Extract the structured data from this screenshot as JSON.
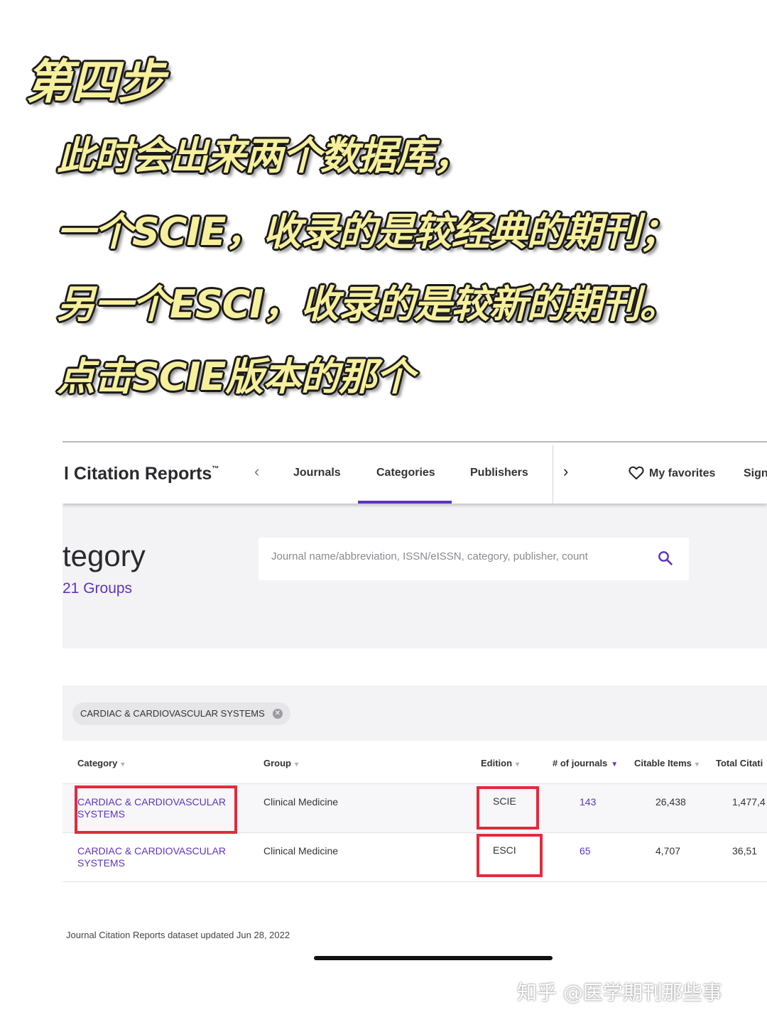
{
  "caption": {
    "step": "第四步",
    "lines": [
      "此时会出来两个数据库，",
      "一个SCIE，收录的是较经典的期刊；",
      "另一个ESCI，收录的是较新的期刊。",
      "点击SCIE版本的那个"
    ]
  },
  "header": {
    "brand": "l Citation Reports",
    "brand_mark": "™",
    "tabs": [
      "Journals",
      "Categories",
      "Publishers"
    ],
    "active_tab": "Categories",
    "favorites": "My favorites",
    "signin": "Sign"
  },
  "page": {
    "title": "tegory",
    "groups": "21 Groups"
  },
  "search": {
    "placeholder": "Journal name/abbreviation, ISSN/eISSN, category, publisher, count"
  },
  "filter_chip": "CARDIAC & CARDIOVASCULAR SYSTEMS",
  "table": {
    "columns": [
      "Category",
      "Group",
      "Edition",
      "# of journals",
      "Citable Items",
      "Total Citati"
    ],
    "rows": [
      {
        "category": "CARDIAC & CARDIOVASCULAR SYSTEMS",
        "group": "Clinical Medicine",
        "edition": "SCIE",
        "journals": "143",
        "citable": "26,438",
        "total": "1,477,4"
      },
      {
        "category": "CARDIAC & CARDIOVASCULAR SYSTEMS",
        "group": "Clinical Medicine",
        "edition": "ESCI",
        "journals": "65",
        "citable": "4,707",
        "total": "36,51"
      }
    ]
  },
  "footer": "Journal Citation Reports dataset updated Jun 28, 2022",
  "watermark": "知乎 @医学期刊那些事",
  "colors": {
    "accent": "#5e33bf",
    "highlight": "#e42a3c",
    "caption_fill": "#f6ef9c"
  }
}
